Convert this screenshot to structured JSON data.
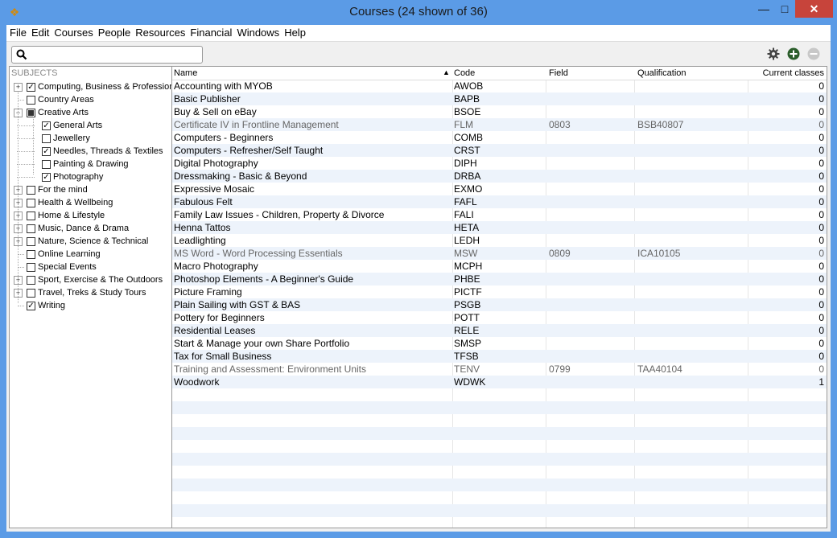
{
  "window": {
    "title": "Courses (24 shown of 36)"
  },
  "menu": [
    "File",
    "Edit",
    "Courses",
    "People",
    "Resources",
    "Financial",
    "Windows",
    "Help"
  ],
  "search": {
    "value": "",
    "placeholder": ""
  },
  "toolbar": {
    "icons": [
      "gear-icon",
      "add-icon",
      "remove-icon"
    ]
  },
  "tree": {
    "heading": "SUBJECTS",
    "items": [
      {
        "label": "Computing, Business & Profession",
        "checked": true,
        "expandable": true,
        "level": 0
      },
      {
        "label": "Country Areas",
        "checked": false,
        "expandable": false,
        "level": 0
      },
      {
        "label": "Creative Arts",
        "checked": "partial",
        "expandable": true,
        "expanded": true,
        "level": 0
      },
      {
        "label": "General Arts",
        "checked": true,
        "level": 1
      },
      {
        "label": "Jewellery",
        "checked": false,
        "level": 1
      },
      {
        "label": "Needles, Threads & Textiles",
        "checked": true,
        "level": 1
      },
      {
        "label": "Painting & Drawing",
        "checked": false,
        "level": 1
      },
      {
        "label": "Photography",
        "checked": true,
        "level": 1
      },
      {
        "label": "For the mind",
        "checked": false,
        "expandable": true,
        "level": 0
      },
      {
        "label": "Health & Wellbeing",
        "checked": false,
        "expandable": true,
        "level": 0
      },
      {
        "label": "Home & Lifestyle",
        "checked": false,
        "expandable": true,
        "level": 0
      },
      {
        "label": "Music, Dance & Drama",
        "checked": false,
        "expandable": true,
        "level": 0
      },
      {
        "label": "Nature, Science & Technical",
        "checked": false,
        "expandable": true,
        "level": 0
      },
      {
        "label": "Online Learning",
        "checked": false,
        "expandable": false,
        "level": 0
      },
      {
        "label": "Special Events",
        "checked": false,
        "expandable": false,
        "level": 0
      },
      {
        "label": "Sport, Exercise & The Outdoors",
        "checked": false,
        "expandable": true,
        "level": 0
      },
      {
        "label": "Travel, Treks & Study Tours",
        "checked": false,
        "expandable": true,
        "level": 0
      },
      {
        "label": "Writing",
        "checked": true,
        "expandable": false,
        "level": 0
      }
    ]
  },
  "table": {
    "columns": {
      "name": "Name",
      "code": "Code",
      "field": "Field",
      "qualification": "Qualification",
      "classes": "Current classes"
    },
    "sort_indicator": "▲",
    "rows": [
      {
        "name": "Accounting with MYOB",
        "code": "AWOB",
        "field": "",
        "qual": "",
        "classes": "0",
        "dim": false
      },
      {
        "name": "Basic Publisher",
        "code": "BAPB",
        "field": "",
        "qual": "",
        "classes": "0",
        "dim": false
      },
      {
        "name": "Buy & Sell on eBay",
        "code": "BSOE",
        "field": "",
        "qual": "",
        "classes": "0",
        "dim": false
      },
      {
        "name": "Certificate IV in Frontline Management",
        "code": "FLM",
        "field": "0803",
        "qual": "BSB40807",
        "classes": "0",
        "dim": true
      },
      {
        "name": "Computers - Beginners",
        "code": "COMB",
        "field": "",
        "qual": "",
        "classes": "0",
        "dim": false
      },
      {
        "name": "Computers - Refresher/Self Taught",
        "code": "CRST",
        "field": "",
        "qual": "",
        "classes": "0",
        "dim": false
      },
      {
        "name": "Digital Photography",
        "code": "DIPH",
        "field": "",
        "qual": "",
        "classes": "0",
        "dim": false
      },
      {
        "name": "Dressmaking - Basic & Beyond",
        "code": "DRBA",
        "field": "",
        "qual": "",
        "classes": "0",
        "dim": false
      },
      {
        "name": "Expressive Mosaic",
        "code": "EXMO",
        "field": "",
        "qual": "",
        "classes": "0",
        "dim": false
      },
      {
        "name": "Fabulous Felt",
        "code": "FAFL",
        "field": "",
        "qual": "",
        "classes": "0",
        "dim": false
      },
      {
        "name": "Family Law Issues - Children, Property & Divorce",
        "code": "FALI",
        "field": "",
        "qual": "",
        "classes": "0",
        "dim": false
      },
      {
        "name": "Henna Tattos",
        "code": "HETA",
        "field": "",
        "qual": "",
        "classes": "0",
        "dim": false
      },
      {
        "name": "Leadlighting",
        "code": "LEDH",
        "field": "",
        "qual": "",
        "classes": "0",
        "dim": false
      },
      {
        "name": "MS Word - Word Processing Essentials",
        "code": "MSW",
        "field": "0809",
        "qual": "ICA10105",
        "classes": "0",
        "dim": true
      },
      {
        "name": "Macro Photography",
        "code": "MCPH",
        "field": "",
        "qual": "",
        "classes": "0",
        "dim": false
      },
      {
        "name": "Photoshop Elements - A Beginner's Guide",
        "code": "PHBE",
        "field": "",
        "qual": "",
        "classes": "0",
        "dim": false
      },
      {
        "name": "Picture Framing",
        "code": "PICTF",
        "field": "",
        "qual": "",
        "classes": "0",
        "dim": false
      },
      {
        "name": "Plain Sailing with GST & BAS",
        "code": "PSGB",
        "field": "",
        "qual": "",
        "classes": "0",
        "dim": false
      },
      {
        "name": "Pottery for Beginners",
        "code": "POTT",
        "field": "",
        "qual": "",
        "classes": "0",
        "dim": false
      },
      {
        "name": "Residential Leases",
        "code": "RELE",
        "field": "",
        "qual": "",
        "classes": "0",
        "dim": false
      },
      {
        "name": "Start & Manage your own Share Portfolio",
        "code": "SMSP",
        "field": "",
        "qual": "",
        "classes": "0",
        "dim": false
      },
      {
        "name": "Tax for Small Business",
        "code": "TFSB",
        "field": "",
        "qual": "",
        "classes": "0",
        "dim": false
      },
      {
        "name": "Training and Assessment: Environment Units",
        "code": "TENV",
        "field": "0799",
        "qual": "TAA40104",
        "classes": "0",
        "dim": true
      },
      {
        "name": "Woodwork",
        "code": "WDWK",
        "field": "",
        "qual": "",
        "classes": "1",
        "dim": false
      }
    ]
  },
  "colors": {
    "titlebar": "#5b9be6",
    "close": "#c7443b",
    "alt_row": "#edf3fb"
  }
}
